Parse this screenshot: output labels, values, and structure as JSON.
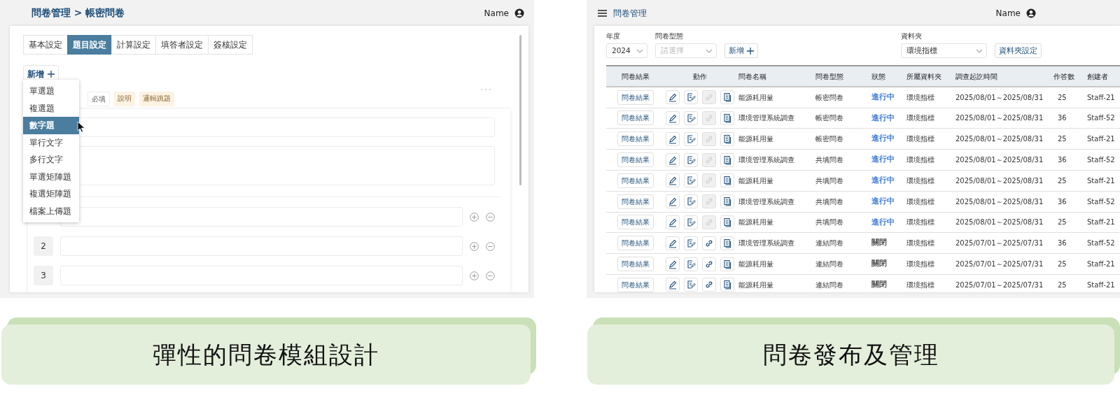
{
  "left": {
    "breadcrumb": "問卷管理 > 帳密問卷",
    "user": "Name",
    "tabs": [
      {
        "label": "基本設定",
        "selected": false
      },
      {
        "label": "題目設定",
        "selected": true
      },
      {
        "label": "計算設定",
        "selected": false
      },
      {
        "label": "填答者設定",
        "selected": false
      },
      {
        "label": "簽核設定",
        "selected": false
      }
    ],
    "add_button": "新增",
    "menu": [
      {
        "label": "單選題",
        "selected": false
      },
      {
        "label": "複選題",
        "selected": false
      },
      {
        "label": "數字題",
        "selected": true
      },
      {
        "label": "單行文字",
        "selected": false
      },
      {
        "label": "多行文字",
        "selected": false
      },
      {
        "label": "單選矩陣題",
        "selected": false
      },
      {
        "label": "複選矩陣題",
        "selected": false
      },
      {
        "label": "檔案上傳題",
        "selected": false
      }
    ],
    "tags": [
      {
        "label": "必填",
        "kind": "plain"
      },
      {
        "label": "說明",
        "kind": "highlight"
      },
      {
        "label": "邏輯跳題",
        "kind": "highlight"
      }
    ],
    "options": [
      {
        "kind": "covered"
      },
      {
        "kind": "numbered",
        "number": "2"
      },
      {
        "kind": "numbered",
        "number": "3"
      }
    ]
  },
  "right": {
    "title": "問卷管理",
    "user": "Name",
    "year": {
      "label": "年度",
      "value": "2024"
    },
    "type_filter": {
      "label": "問卷型態",
      "placeholder": "請選擇"
    },
    "add_button": "新增",
    "folder": {
      "label": "資料夾",
      "value": "環境指標"
    },
    "folder_button": "資料夾設定",
    "columns": [
      "問卷結果",
      "動作",
      "問卷名稱",
      "問卷型態",
      "狀態",
      "所屬資料夾",
      "調查起訖時間",
      "作答數",
      "創建者"
    ],
    "rows": [
      {
        "result": "問卷結果",
        "link_disabled": true,
        "name": "能源耗用量",
        "type": "帳密問卷",
        "status": {
          "text": "進行中",
          "color": "#3d7ad6"
        },
        "folder": "環境指標",
        "period": "2025/08/01～2025/08/31",
        "answers": "25",
        "creator": "Staff-21"
      },
      {
        "result": "問卷結果",
        "link_disabled": true,
        "name": "環境管理系統調查",
        "type": "帳密問卷",
        "status": {
          "text": "進行中",
          "color": "#3d7ad6"
        },
        "folder": "環境指標",
        "period": "2025/08/01～2025/08/31",
        "answers": "36",
        "creator": "Staff-52"
      },
      {
        "result": "問卷結果",
        "link_disabled": true,
        "name": "能源耗用量",
        "type": "帳密問卷",
        "status": {
          "text": "進行中",
          "color": "#3d7ad6"
        },
        "folder": "環境指標",
        "period": "2025/08/01～2025/08/31",
        "answers": "25",
        "creator": "Staff-21"
      },
      {
        "result": "問卷結果",
        "link_disabled": true,
        "name": "環境管理系統調查",
        "type": "共填問卷",
        "status": {
          "text": "進行中",
          "color": "#3d7ad6"
        },
        "folder": "環境指標",
        "period": "2025/08/01～2025/08/31",
        "answers": "36",
        "creator": "Staff-52"
      },
      {
        "result": "問卷結果",
        "link_disabled": true,
        "name": "能源耗用量",
        "type": "共填問卷",
        "status": {
          "text": "進行中",
          "color": "#3d7ad6"
        },
        "folder": "環境指標",
        "period": "2025/08/01～2025/08/31",
        "answers": "25",
        "creator": "Staff-21"
      },
      {
        "result": "問卷結果",
        "link_disabled": true,
        "name": "環境管理系統調查",
        "type": "共填問卷",
        "status": {
          "text": "進行中",
          "color": "#3d7ad6"
        },
        "folder": "環境指標",
        "period": "2025/08/01～2025/08/31",
        "answers": "36",
        "creator": "Staff-52"
      },
      {
        "result": "問卷結果",
        "link_disabled": true,
        "name": "能源耗用量",
        "type": "共填問卷",
        "status": {
          "text": "進行中",
          "color": "#3d7ad6"
        },
        "folder": "環境指標",
        "period": "2025/08/01～2025/08/31",
        "answers": "25",
        "creator": "Staff-21"
      },
      {
        "result": "問卷結果",
        "link_disabled": false,
        "name": "環境管理系統調查",
        "type": "連結問卷",
        "status": {
          "text": "關閉",
          "color": "#555555"
        },
        "folder": "環境指標",
        "period": "2025/07/01～2025/07/31",
        "answers": "36",
        "creator": "Staff-52"
      },
      {
        "result": "問卷結果",
        "link_disabled": false,
        "name": "能源耗用量",
        "type": "連結問卷",
        "status": {
          "text": "關閉",
          "color": "#555555"
        },
        "folder": "環境指標",
        "period": "2025/07/01～2025/07/31",
        "answers": "25",
        "creator": "Staff-21"
      },
      {
        "result": "問卷結果",
        "link_disabled": false,
        "name": "能源耗用量",
        "type": "連結問卷",
        "status": {
          "text": "關閉",
          "color": "#555555"
        },
        "folder": "環境指標",
        "period": "2025/07/01～2025/07/31",
        "answers": "25",
        "creator": "Staff-21"
      }
    ]
  },
  "captions": [
    "彈性的問卷模組設計",
    "問卷發布及管理"
  ]
}
